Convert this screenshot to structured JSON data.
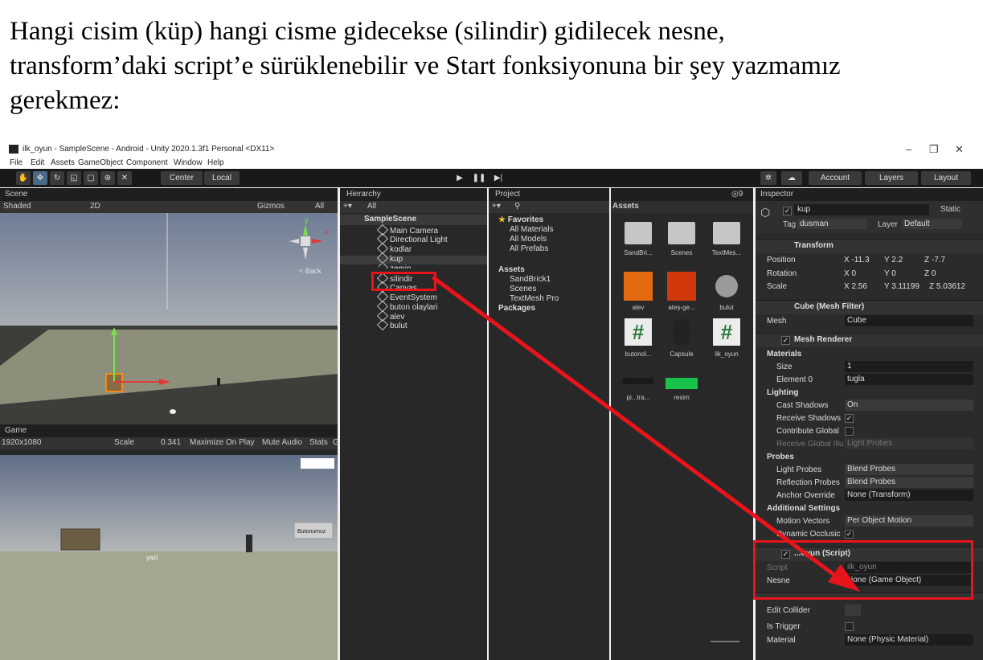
{
  "caption": {
    "line1": "Hangi cisim (küp) hangi cisme gidecekse (silindir) gidilecek nesne,",
    "line2": "transform’daki script’e sürüklenebilir ve Start fonksiyonuna bir şey yazmamız",
    "line3": "gerekmez:"
  },
  "window": {
    "title": "ilk_oyun - SampleScene - Android - Unity 2020.1.3f1 Personal <DX11>"
  },
  "menu": [
    "File",
    "Edit",
    "Assets",
    "GameObject",
    "Component",
    "Window",
    "Help"
  ],
  "toolbar": {
    "center": "Center",
    "local": "Local",
    "account": "Account",
    "layers": "Layers",
    "layout": "Layout"
  },
  "scene": {
    "tab": "Scene",
    "shading": "Shaded",
    "mode2d": "2D",
    "gizmos": "Gizmos",
    "search": "All",
    "back": "< Back",
    "axis_y": "y",
    "axis_x": "x"
  },
  "game": {
    "tab": "Game",
    "resolution": "1920x1080",
    "scale_label": "Scale",
    "scale_value": "0.341",
    "maximize": "Maximize On Play",
    "mute": "Mute Audio",
    "stats": "Stats",
    "gizmos_cut": "G",
    "button_text": "Butonumuz",
    "text_label": "yazi"
  },
  "hierarchy": {
    "tab": "Hierarchy",
    "search": "All",
    "scene": "SampleScene",
    "items": [
      "Main Camera",
      "Directional Light",
      "kodlar",
      "kup",
      "zemin",
      "silindir",
      "Canvas",
      "EventSystem",
      "buton olaylari",
      "alev",
      "bulut"
    ]
  },
  "project": {
    "tab": "Project",
    "favorites": "Favorites",
    "fav_items": [
      "All Materials",
      "All Models",
      "All Prefabs"
    ],
    "assets": "Assets",
    "asset_folders": [
      "SandBrick1",
      "Scenes",
      "TextMesh Pro"
    ],
    "packages": "Packages",
    "grid_title": "Assets",
    "grid": [
      "SandBri...",
      "Scenes",
      "TextMes...",
      "alev",
      "ateş-ge...",
      "bulut",
      "butonol...",
      "Capsule",
      "ilk_oyun",
      "pi...tra...",
      "resim"
    ]
  },
  "inspector": {
    "tab": "Inspector",
    "name": "kup",
    "static": "Static",
    "tag_label": "Tag",
    "tag": "dusman",
    "layer_label": "Layer",
    "layer": "Default",
    "transform": "Transform",
    "position_label": "Position",
    "position": [
      "X -11.3",
      "Y 2.2",
      "Z -7.7"
    ],
    "rotation_label": "Rotation",
    "rotation": [
      "X 0",
      "Y 0",
      "Z 0"
    ],
    "scale_label": "Scale",
    "scale": [
      "X 2.56",
      "Y 3.11199",
      "Z 5.03612"
    ],
    "mesh_filter": "Cube (Mesh Filter)",
    "mesh_label": "Mesh",
    "mesh": "Cube",
    "mesh_renderer": "Mesh Renderer",
    "materials": "Materials",
    "size_label": "Size",
    "size": "1",
    "element0_label": "Element 0",
    "element0": "tugla",
    "lighting": "Lighting",
    "cast_shadows_label": "Cast Shadows",
    "cast_shadows": "On",
    "receive_shadows": "Receive Shadows",
    "contribute_global": "Contribute Global",
    "receive_gi_label": "Receive Global Illu",
    "receive_gi": "Light Probes",
    "probes": "Probes",
    "light_probes_label": "Light Probes",
    "light_probes": "Blend Probes",
    "reflection_probes_label": "Reflection Probes",
    "reflection_probes": "Blend Probes",
    "anchor_label": "Anchor Override",
    "anchor": "None (Transform)",
    "additional": "Additional Settings",
    "motion_label": "Motion Vectors",
    "motion": "Per Object Motion",
    "dynamic_occlusion": "Dynamic Occlusic",
    "script_component": "...oyun (Script)",
    "script_label": "Script",
    "script": "ilk_oyun",
    "nesne_label": "Nesne",
    "nesne": "None (Game Object)",
    "edit_collider": "Edit Collider",
    "is_trigger": "Is Trigger",
    "material_label": "Material",
    "material": "None (Physic Material)"
  },
  "colors": {
    "annotation": "#e8141b",
    "unity_dark": "#282828",
    "selection": "#2c5d87"
  }
}
